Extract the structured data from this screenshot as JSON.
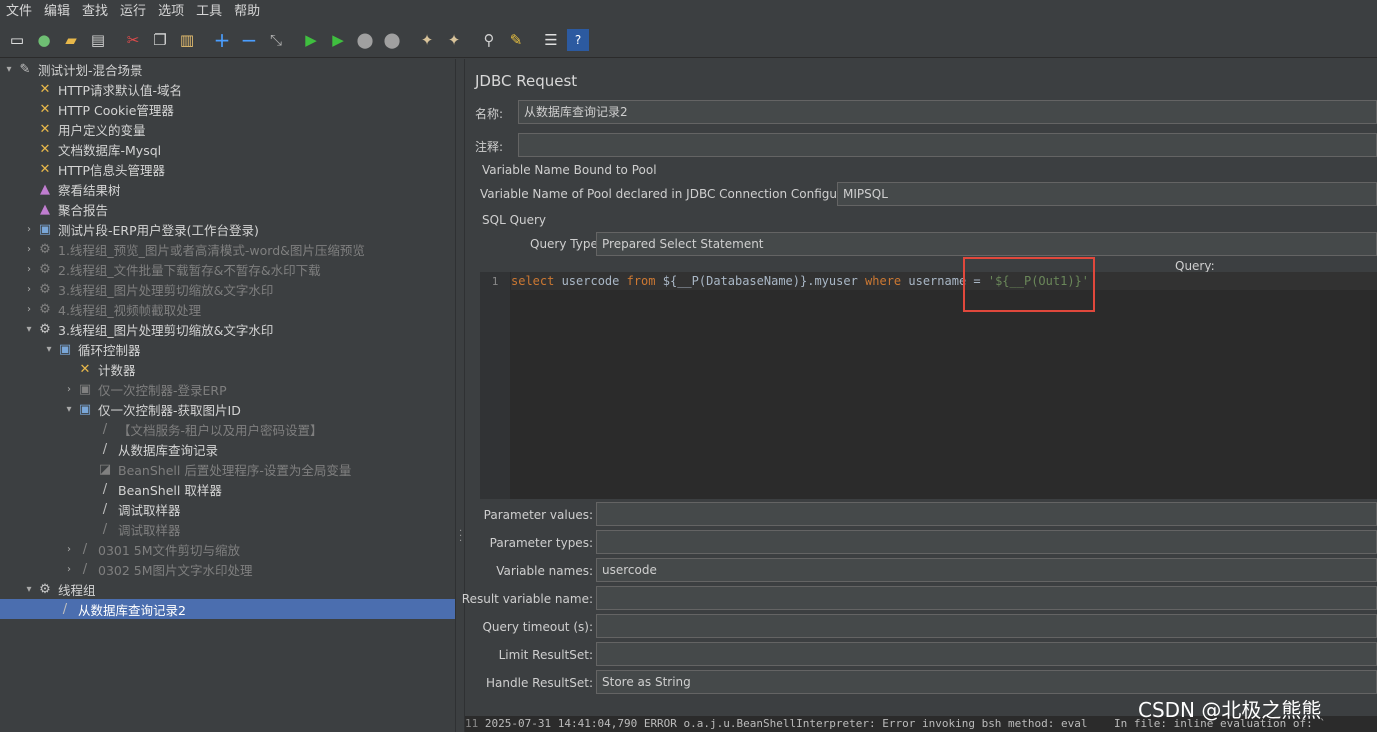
{
  "menubar": {
    "items": [
      "文件",
      "编辑",
      "查找",
      "运行",
      "选项",
      "工具",
      "帮助"
    ]
  },
  "toolbar": {
    "icons": [
      "new-icon",
      "templates-icon",
      "open-icon",
      "save-icon",
      "cut-icon",
      "copy-icon",
      "paste-icon",
      "expand-icon",
      "collapse-icon",
      "toggle-icon",
      "start-icon",
      "start-no-pause-icon",
      "stop-icon",
      "shutdown-icon",
      "clear-icon",
      "clear-all-icon",
      "search-icon",
      "reset-search-icon",
      "function-helper-icon",
      "help-icon"
    ]
  },
  "tree": {
    "rows": [
      {
        "label": "测试计划-混合场景",
        "level": 0,
        "caret": "▾",
        "icon": "✎",
        "disabled": false
      },
      {
        "label": "HTTP请求默认值-域名",
        "level": 1,
        "caret": "",
        "icon": "✕",
        "disabled": false
      },
      {
        "label": "HTTP Cookie管理器",
        "level": 1,
        "caret": "",
        "icon": "✕",
        "disabled": false
      },
      {
        "label": "用户定义的变量",
        "level": 1,
        "caret": "",
        "icon": "✕",
        "disabled": false
      },
      {
        "label": "文档数据库-Mysql",
        "level": 1,
        "caret": "",
        "icon": "✕",
        "disabled": false
      },
      {
        "label": "HTTP信息头管理器",
        "level": 1,
        "caret": "",
        "icon": "✕",
        "disabled": false
      },
      {
        "label": "察看结果树",
        "level": 1,
        "caret": "",
        "icon": "▲",
        "disabled": false
      },
      {
        "label": "聚合报告",
        "level": 1,
        "caret": "",
        "icon": "▲",
        "disabled": false
      },
      {
        "label": "测试片段-ERP用户登录(工作台登录)",
        "level": 1,
        "caret": "›",
        "icon": "▣",
        "disabled": false
      },
      {
        "label": "1.线程组_预览_图片或者高清模式-word&图片压缩预览",
        "level": 1,
        "caret": "›",
        "icon": "⚙",
        "disabled": true
      },
      {
        "label": "2.线程组_文件批量下载暂存&不暂存&水印下载",
        "level": 1,
        "caret": "›",
        "icon": "⚙",
        "disabled": true
      },
      {
        "label": "3.线程组_图片处理剪切缩放&文字水印",
        "level": 1,
        "caret": "›",
        "icon": "⚙",
        "disabled": true
      },
      {
        "label": "4.线程组_视频帧截取处理",
        "level": 1,
        "caret": "›",
        "icon": "⚙",
        "disabled": true
      },
      {
        "label": "3.线程组_图片处理剪切缩放&文字水印",
        "level": 1,
        "caret": "▾",
        "icon": "⚙",
        "disabled": false
      },
      {
        "label": "循环控制器",
        "level": 2,
        "caret": "▾",
        "icon": "▣",
        "disabled": false
      },
      {
        "label": "计数器",
        "level": 3,
        "caret": "",
        "icon": "✕",
        "disabled": false
      },
      {
        "label": "仅一次控制器-登录ERP",
        "level": 3,
        "caret": "›",
        "icon": "▣",
        "disabled": true
      },
      {
        "label": "仅一次控制器-获取图片ID",
        "level": 3,
        "caret": "▾",
        "icon": "▣",
        "disabled": false
      },
      {
        "label": "【文档服务-租户以及用户密码设置】",
        "level": 4,
        "caret": "",
        "icon": "/",
        "disabled": true
      },
      {
        "label": "从数据库查询记录",
        "level": 4,
        "caret": "",
        "icon": "/",
        "disabled": false
      },
      {
        "label": "BeanShell 后置处理程序-设置为全局变量",
        "level": 4,
        "caret": "",
        "icon": "◪",
        "disabled": true
      },
      {
        "label": "BeanShell 取样器",
        "level": 4,
        "caret": "",
        "icon": "/",
        "disabled": false
      },
      {
        "label": "调试取样器",
        "level": 4,
        "caret": "",
        "icon": "/",
        "disabled": false
      },
      {
        "label": "调试取样器",
        "level": 4,
        "caret": "",
        "icon": "/",
        "disabled": true
      },
      {
        "label": "0301 5M文件剪切与缩放",
        "level": 3,
        "caret": "›",
        "icon": "/",
        "disabled": true
      },
      {
        "label": "0302 5M图片文字水印处理",
        "level": 3,
        "caret": "›",
        "icon": "/",
        "disabled": true
      },
      {
        "label": "线程组",
        "level": 1,
        "caret": "▾",
        "icon": "⚙",
        "disabled": false
      },
      {
        "label": "从数据库查询记录2",
        "level": 2,
        "caret": "",
        "icon": "/",
        "disabled": false,
        "selected": true
      }
    ]
  },
  "panel": {
    "title": "JDBC Request",
    "name_label": "名称:",
    "name_value": "从数据库查询记录2",
    "comment_label": "注释:",
    "comment_value": "",
    "pool_section": "Variable Name Bound to Pool",
    "pool_label": "Variable Name of Pool declared in JDBC Connection Configuration:",
    "pool_value": "MIPSQL",
    "sql_section": "SQL Query",
    "query_type_label": "Query Type:",
    "query_type_value": "Prepared Select Statement",
    "query_label": "Query:",
    "line_number": "1",
    "code": {
      "kw_select": "select",
      "part1": " usercode ",
      "kw_from": "from",
      "part2": " ${__P(DatabaseName)}.myuser ",
      "kw_where": "where",
      "part3": " username = ",
      "str": "'${__P(Out1)}'"
    },
    "fields": [
      {
        "label": "Parameter values:",
        "value": ""
      },
      {
        "label": "Parameter types:",
        "value": ""
      },
      {
        "label": "Variable names:",
        "value": "usercode"
      },
      {
        "label": "Result variable name:",
        "value": ""
      },
      {
        "label": "Query timeout (s):",
        "value": ""
      },
      {
        "label": "Limit ResultSet:",
        "value": ""
      },
      {
        "label": "Handle ResultSet:",
        "value": "Store as String"
      }
    ]
  },
  "console": {
    "line_prefix": "11",
    "text": "2025-07-31 14:41:04,790 ERROR o.a.j.u.BeanShellInterpreter: Error invoking bsh method: eval    In file: inline evaluation of: `"
  },
  "watermark": "CSDN @北极之熊熊"
}
